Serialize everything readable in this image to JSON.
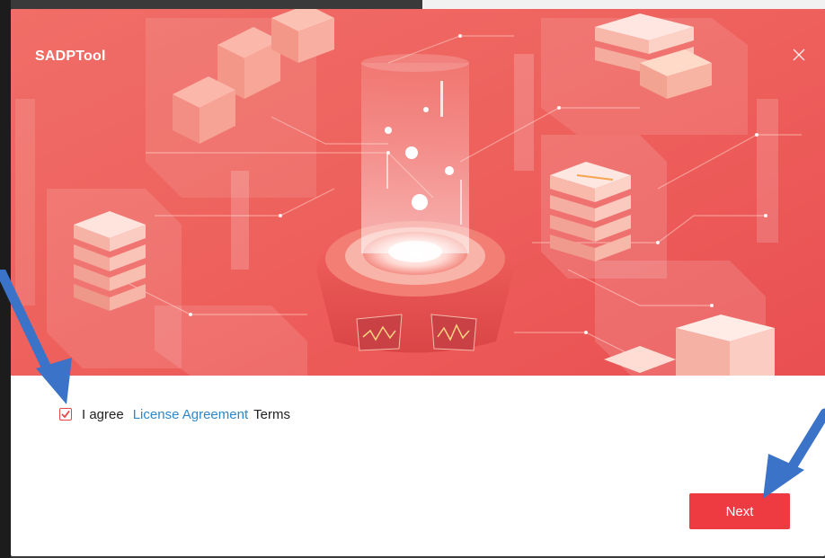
{
  "window": {
    "app_title": "SADPTool"
  },
  "agreement": {
    "checked": true,
    "prefix": "I agree",
    "link_text": "License Agreement",
    "suffix": "Terms"
  },
  "footer": {
    "next_label": "Next"
  },
  "icons": {
    "close": "close-icon",
    "check": "check-icon"
  },
  "colors": {
    "accent": "#ee3a41",
    "banner_base": "#ef5a55",
    "link": "#2f86c9",
    "annotation_arrow": "#3a73c8"
  }
}
